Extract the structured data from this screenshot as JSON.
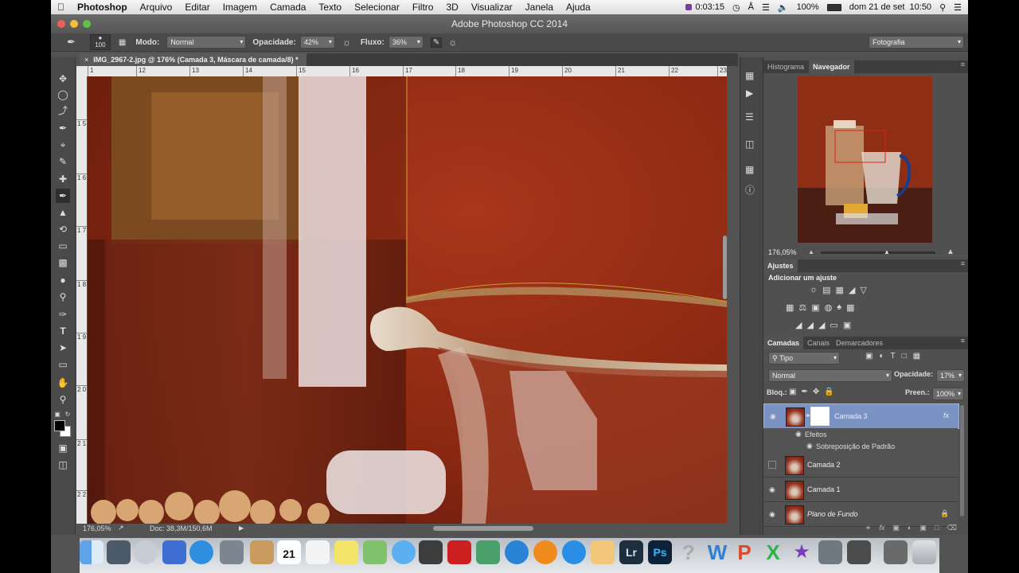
{
  "menubar": {
    "app": "Photoshop",
    "items": [
      "Arquivo",
      "Editar",
      "Imagem",
      "Camada",
      "Texto",
      "Selecionar",
      "Filtro",
      "3D",
      "Visualizar",
      "Janela",
      "Ajuda"
    ],
    "timer": "0:03:15",
    "battery": "100%",
    "datetime": "dom 21 de set  10:50"
  },
  "window": {
    "title": "Adobe Photoshop CC 2014"
  },
  "options": {
    "brush_size": "100",
    "mode_label": "Modo:",
    "mode_value": "Normal",
    "opacity_label": "Opacidade:",
    "opacity_value": "42%",
    "flow_label": "Fluxo:",
    "flow_value": "36%",
    "workspace": "Fotografia"
  },
  "document": {
    "tab_title": "IMG_2967-2.jpg @ 176% (Camada 3, Máscara de camada/8) *",
    "zoom": "176,05%",
    "doc_info": "Doc: 38,3M/150,6M"
  },
  "ruler": {
    "h_ticks": [
      "1",
      "12",
      "13",
      "14",
      "15",
      "16",
      "17",
      "18",
      "19",
      "20",
      "21",
      "22",
      "23"
    ],
    "v_ticks": [
      "1 5",
      "1 6",
      "1 7",
      "1 8",
      "1 9",
      "2 0",
      "2 1",
      "2 2"
    ]
  },
  "navigator": {
    "tabs": [
      "Histograma",
      "Navegador"
    ],
    "zoom": "176,05%"
  },
  "adjustments": {
    "tab": "Ajustes",
    "heading": "Adicionar um ajuste"
  },
  "layers_panel": {
    "tabs": [
      "Camadas",
      "Canais",
      "Demarcadores"
    ],
    "filter": "Tipo",
    "blend_mode": "Normal",
    "opacity_label": "Opacidade:",
    "opacity_value": "17%",
    "lock_label": "Bloq.:",
    "fill_label": "Preen.:",
    "fill_value": "100%",
    "layers": [
      {
        "name": "Camada 3",
        "selected": true,
        "visible": true
      },
      {
        "name": "Camada 2",
        "selected": false,
        "visible": false
      },
      {
        "name": "Camada 1",
        "selected": false,
        "visible": true
      },
      {
        "name": "Plano de Fundo",
        "selected": false,
        "visible": true
      }
    ],
    "effects_label": "Efeitos",
    "effect_item": "Sobreposição de Padrão"
  },
  "dock": {
    "calendar_day": "21",
    "lr": "Lr",
    "ps": "Ps"
  },
  "colors": {
    "selection_blue": "#7b93c4",
    "canvas_red": "#8a2a12",
    "ui_dark": "#535353"
  }
}
